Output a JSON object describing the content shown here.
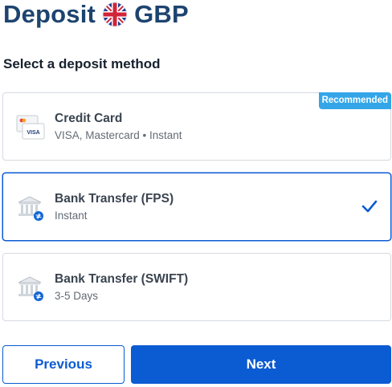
{
  "header": {
    "title_prefix": "Deposit",
    "currency": "GBP",
    "flag_icon": "uk-flag-icon"
  },
  "section": {
    "heading": "Select a deposit method"
  },
  "methods": [
    {
      "title": "Credit Card",
      "subtitle": "VISA, Mastercard • Instant",
      "badge": "Recommended",
      "icon": "credit-card-icon",
      "selected": false
    },
    {
      "title": "Bank Transfer (FPS)",
      "subtitle": "Instant",
      "icon": "bank-icon",
      "selected": true
    },
    {
      "title": "Bank Transfer (SWIFT)",
      "subtitle": "3-5 Days",
      "icon": "bank-icon",
      "selected": false
    }
  ],
  "buttons": {
    "previous": "Previous",
    "next": "Next"
  },
  "colors": {
    "primary": "#0b5bd3",
    "title": "#1d4470",
    "badge": "#34a6e8",
    "border": "#d5d9df"
  }
}
